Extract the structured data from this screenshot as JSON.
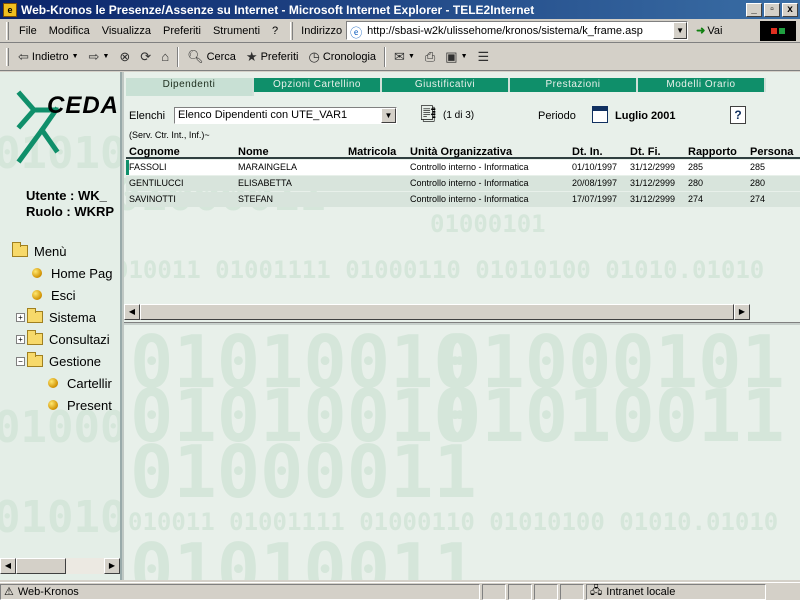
{
  "window": {
    "title": "Web-Kronos le Presenze/Assenze su Internet - Microsoft Internet Explorer - TELE2Internet",
    "controls": [
      "_",
      "ȅ",
      "x"
    ]
  },
  "menu": {
    "items": [
      "File",
      "Modifica",
      "Visualizza",
      "Preferiti",
      "Strumenti",
      "?"
    ],
    "address_label": "Indirizzo",
    "address_value": "http://sbasi-w2k/ulissehome/kronos/sistema/k_frame.asp",
    "go_label": "Vai"
  },
  "toolbar": {
    "back": "Indietro",
    "search": "Cerca",
    "favorites": "Preferiti",
    "history": "Cronologia"
  },
  "sidebar": {
    "logo": "CEDA",
    "user_label": "Utente : WK_",
    "role_label": "Ruolo : WKRP",
    "tree": [
      {
        "label": "Menù",
        "type": "folder-open"
      },
      {
        "label": "Home Pag",
        "type": "leaf"
      },
      {
        "label": "Esci",
        "type": "leaf"
      },
      {
        "label": "Sistema",
        "type": "folder"
      },
      {
        "label": "Consultazi",
        "type": "folder"
      },
      {
        "label": "Gestione",
        "type": "folder-open"
      },
      {
        "label": "Cartellir",
        "type": "leaf"
      },
      {
        "label": "Present",
        "type": "leaf"
      }
    ]
  },
  "tabs": [
    {
      "label": "Dipendenti",
      "active": true
    },
    {
      "label": "Opzioni Cartellino",
      "active": false
    },
    {
      "label": "Giustificativi",
      "active": false
    },
    {
      "label": "Prestazioni",
      "active": false
    },
    {
      "label": "Modelli Orario",
      "active": false
    }
  ],
  "filters": {
    "elenchi_label": "Elenchi",
    "elenchi_value": "Elenco Dipendenti con UTE_VAR1",
    "pager": "(1 di 3)",
    "periodo_label": "Periodo",
    "periodo_value": "Luglio 2001",
    "serv_text": "(Serv. Ctr. Int., Inf.)~"
  },
  "grid": {
    "columns": [
      "Cognome",
      "Nome",
      "Matricola",
      "Unità Organizzativa",
      "Dt. In.",
      "Dt. Fi.",
      "Rapporto",
      "Persona"
    ],
    "rows": [
      [
        "FASSOLI",
        "MARAINGELA",
        "",
        "Controllo interno - Informatica",
        "01/10/1997",
        "31/12/2999",
        "285",
        "285"
      ],
      [
        "GENTILUCCI",
        "ELISABETTA",
        "",
        "Controllo interno - Informatica",
        "20/08/1997",
        "31/12/2999",
        "280",
        "280"
      ],
      [
        "SAVINOTTI",
        "STEFAN",
        "",
        "Controllo interno - Informatica",
        "17/07/1997",
        "31/12/2999",
        "274",
        "274"
      ]
    ]
  },
  "status": {
    "left_text": "Web-Kronos",
    "zone_text": "Intranet locale"
  },
  "background_binary": [
    "01010010",
    "01000101",
    "01010011",
    "01000011",
    "010011 01001111 01000110 01010100 01010.01010"
  ]
}
